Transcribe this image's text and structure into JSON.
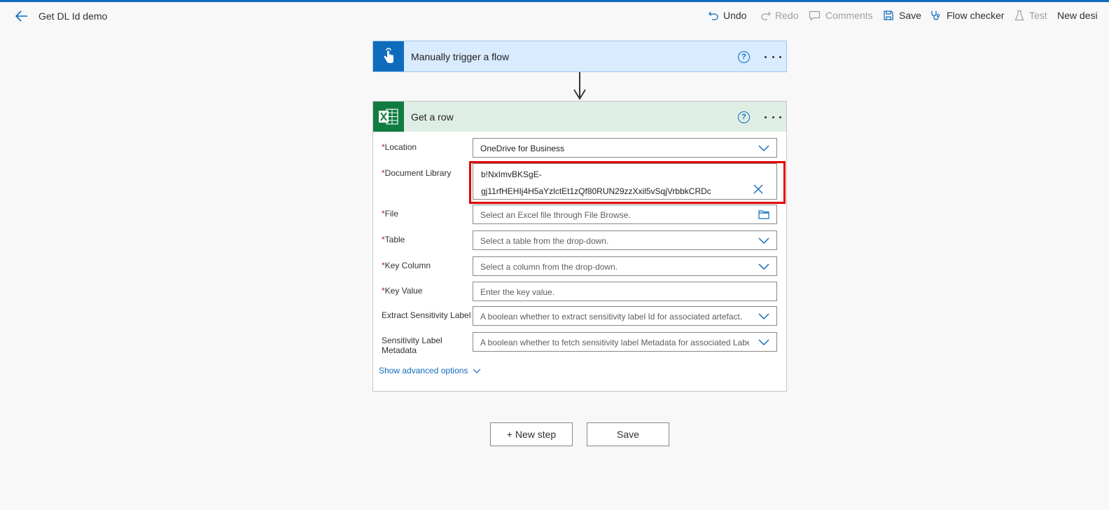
{
  "header": {
    "title": "Get DL Id demo",
    "undo": "Undo",
    "redo": "Redo",
    "comments": "Comments",
    "save": "Save",
    "flow_checker": "Flow checker",
    "test": "Test",
    "new_designer": "New desi"
  },
  "trigger": {
    "title": "Manually trigger a flow",
    "help": "?"
  },
  "action": {
    "title": "Get a row",
    "help": "?",
    "fields": {
      "location": {
        "label": "Location",
        "value": "OneDrive for Business"
      },
      "document_library": {
        "label": "Document Library",
        "value_line1": "b!NxImvBKSgE-",
        "value_line2": "gj11rfHEHIj4H5aYzlctEt1zQf80RUN29zzXxil5vSqjVrbbkCRDc"
      },
      "file": {
        "label": "File",
        "placeholder": "Select an Excel file through File Browse."
      },
      "table": {
        "label": "Table",
        "placeholder": "Select a table from the drop-down."
      },
      "key_column": {
        "label": "Key Column",
        "placeholder": "Select a column from the drop-down."
      },
      "key_value": {
        "label": "Key Value",
        "placeholder": "Enter the key value."
      },
      "extract_sensitivity": {
        "label": "Extract Sensitivity Label",
        "placeholder": "A boolean whether to extract sensitivity label Id for associated artefact."
      },
      "sensitivity_metadata": {
        "label_line1": "Sensitivity Label",
        "label_line2": "Metadata",
        "placeholder": "A boolean whether to fetch sensitivity label Metadata for associated Label"
      }
    },
    "required_mark": "*",
    "show_advanced": "Show advanced options"
  },
  "footer": {
    "new_step": "+ New step",
    "save": "Save"
  },
  "colors": {
    "accent": "#0f6cbd",
    "excel_green": "#107c41",
    "trigger_bg": "#d9ebff",
    "action_header_bg": "#dfeee4",
    "highlight": "#e00000"
  },
  "icons": [
    "back-arrow-icon",
    "undo-icon",
    "redo-icon",
    "comment-icon",
    "save-icon",
    "stethoscope-icon",
    "flask-icon",
    "touch-icon",
    "excel-icon",
    "help-icon",
    "more-icon",
    "chevron-down-icon",
    "close-icon",
    "folder-icon"
  ]
}
